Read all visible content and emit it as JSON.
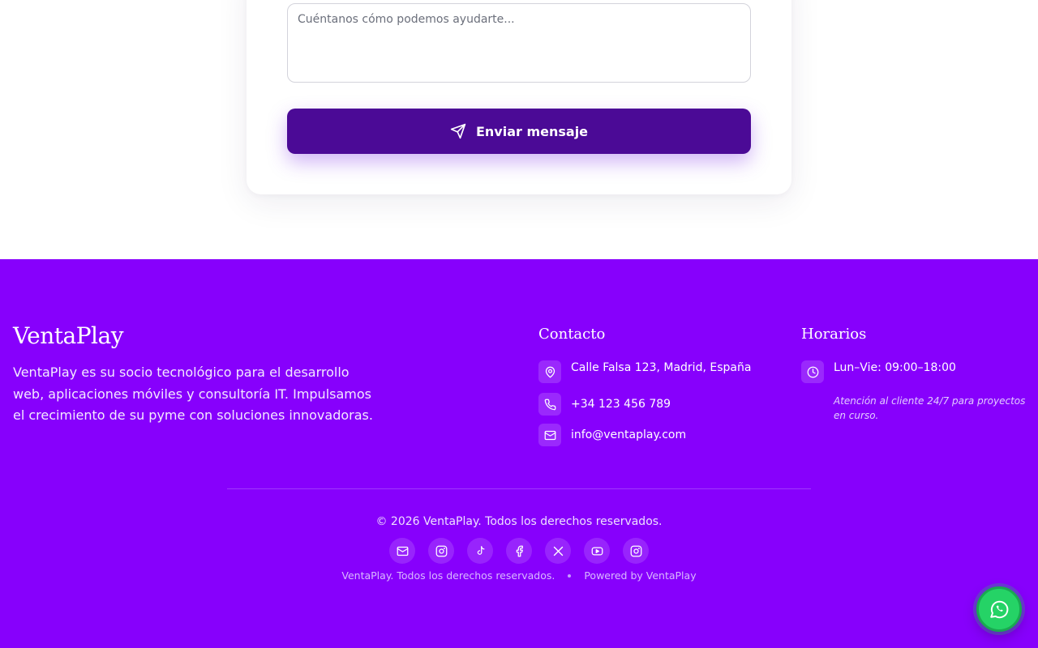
{
  "form": {
    "message_placeholder": "Cuéntanos cómo podemos ayudarte...",
    "send_label": "Enviar mensaje"
  },
  "footer": {
    "brand": "VentaPlay",
    "description": "VentaPlay es su socio tecnológico para el desarrollo web, aplicaciones móviles y consultoría IT. Impulsamos el crecimiento de su pyme con soluciones innovadoras.",
    "contact": {
      "title": "Contacto",
      "address": "Calle Falsa 123, Madrid, España",
      "phone": "+34 123 456 789",
      "email": "info@ventaplay.com"
    },
    "hours": {
      "title": "Horarios",
      "schedule": "Lun–Vie: 09:00–18:00",
      "note": "Atención al cliente 24/7 para proyectos en curso."
    },
    "copyright": "© 2026 VentaPlay. Todos los derechos reservados.",
    "socials": [
      {
        "icon": "mail-icon"
      },
      {
        "icon": "instagram-icon"
      },
      {
        "icon": "tiktok-icon"
      },
      {
        "icon": "facebook-icon"
      },
      {
        "icon": "x-icon"
      },
      {
        "icon": "youtube-icon"
      },
      {
        "icon": "instagram-icon"
      }
    ],
    "rights": "VentaPlay. Todos los derechos reservados.",
    "powered_by": "Powered by VentaPlay"
  },
  "colors": {
    "footer_bg": "#8700fc",
    "button_bg": "#4b0a96",
    "whatsapp": "#25d366"
  }
}
